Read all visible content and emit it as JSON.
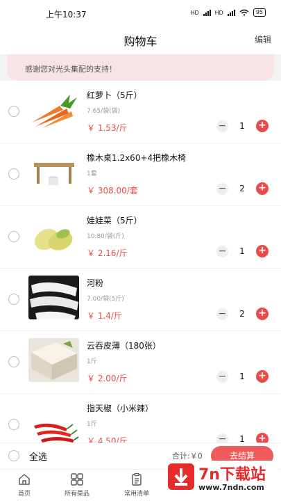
{
  "status_bar": {
    "time": "上午10:37",
    "net1": "HD",
    "net2": "HD",
    "battery": "95"
  },
  "nav": {
    "title": "购物车",
    "edit_label": "编辑"
  },
  "notice": {
    "text": "感谢您对光头集配的支持！"
  },
  "cart_items": [
    {
      "name": "红萝卜（5斤）",
      "spec": "7.65/袋(袋)",
      "price": "￥ 1.53/斤",
      "qty": "1"
    },
    {
      "name": "橡木桌1.2x60+4把橡木椅",
      "spec": "1套",
      "price": "￥ 308.00/套",
      "qty": "2"
    },
    {
      "name": "娃娃菜（5斤）",
      "spec": "10.80/袋(斤)",
      "price": "￥ 2.16/斤",
      "qty": "1"
    },
    {
      "name": "河粉",
      "spec": "7.00/袋(5斤)",
      "price": "￥ 1.4/斤",
      "qty": "2"
    },
    {
      "name": "云吞皮薄（180张）",
      "spec": "1斤",
      "price": "￥ 2.00/斤",
      "qty": "1"
    },
    {
      "name": "指天椒（小米辣）",
      "spec": "1斤",
      "price": "￥ 4.50/斤",
      "qty": "1"
    }
  ],
  "footer": {
    "select_all": "全选",
    "total": "合计:￥0",
    "checkout": "去结算"
  },
  "tabs": [
    {
      "label": "首页",
      "icon": "home-icon"
    },
    {
      "label": "所有菜品",
      "icon": "grid-icon"
    },
    {
      "label": "常用清单",
      "icon": "clipboard-icon"
    }
  ],
  "watermark": {
    "brand": "7n下载站",
    "url": "www.7ndn.com"
  },
  "colors": {
    "accent": "#e94b4b",
    "notice_bg": "#f8e4e6",
    "checkout": "#ef5a5a"
  }
}
